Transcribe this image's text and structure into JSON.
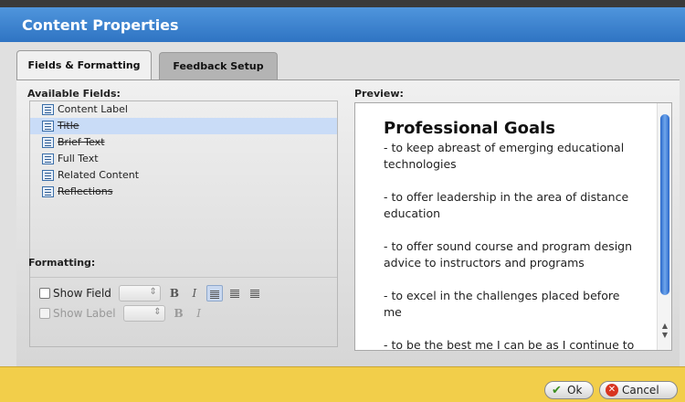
{
  "window": {
    "title": "Content Properties"
  },
  "tabs": [
    {
      "label": "Fields & Formatting",
      "active": true
    },
    {
      "label": "Feedback Setup",
      "active": false
    }
  ],
  "available_fields": {
    "label": "Available Fields:",
    "items": [
      {
        "label": "Content Label",
        "struck": false,
        "selected": false
      },
      {
        "label": "Title",
        "struck": true,
        "selected": true
      },
      {
        "label": "Brief Text",
        "struck": true,
        "selected": false
      },
      {
        "label": "Full Text",
        "struck": false,
        "selected": false
      },
      {
        "label": "Related Content",
        "struck": false,
        "selected": false
      },
      {
        "label": "Reflections",
        "struck": true,
        "selected": false
      }
    ]
  },
  "formatting": {
    "label": "Formatting:",
    "show_field_label": "Show Field",
    "show_label_label": "Show Label",
    "bold_glyph": "B",
    "italic_glyph": "I"
  },
  "preview": {
    "label": "Preview:",
    "heading": "Professional Goals",
    "items": [
      "- to keep abreast of emerging educational technologies",
      "- to offer leadership in the area of distance education",
      "- to offer sound course and program design advice to instructors and programs",
      "- to excel in the challenges placed before me",
      "- to be the best me I can be as I continue to learn, grow and change"
    ]
  },
  "footer": {
    "ok_label": "Ok",
    "cancel_label": "Cancel"
  },
  "colors": {
    "title_bar": "#3a82d2",
    "footer": "#f2ce4a",
    "selection": "#c9dcf7",
    "scroll_thumb": "#3f7fd8"
  }
}
